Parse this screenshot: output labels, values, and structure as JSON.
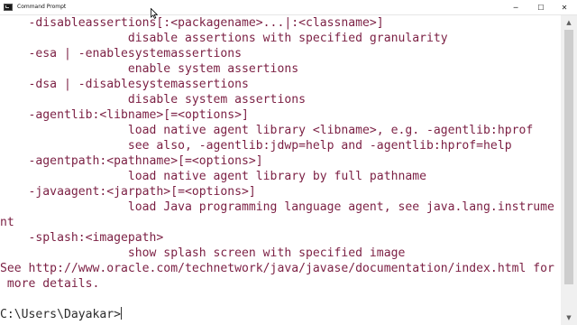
{
  "window": {
    "title": "Command Prompt",
    "min_glyph": "─",
    "max_glyph": "☐",
    "close_glyph": "✕"
  },
  "console": {
    "lines": [
      "    -disableassertions[:<packagename>...|:<classname>]",
      "                  disable assertions with specified granularity",
      "    -esa | -enablesystemassertions",
      "                  enable system assertions",
      "    -dsa | -disablesystemassertions",
      "                  disable system assertions",
      "    -agentlib:<libname>[=<options>]",
      "                  load native agent library <libname>, e.g. -agentlib:hprof",
      "                  see also, -agentlib:jdwp=help and -agentlib:hprof=help",
      "    -agentpath:<pathname>[=<options>]",
      "                  load native agent library by full pathname",
      "    -javaagent:<jarpath>[=<options>]",
      "                  load Java programming language agent, see java.lang.instrume",
      "nt",
      "    -splash:<imagepath>",
      "                  show splash screen with specified image",
      "See http://www.oracle.com/technetwork/java/javase/documentation/index.html for",
      " more details.",
      ""
    ],
    "prompt": "C:\\Users\\Dayakar>"
  },
  "scrollbar": {
    "up_glyph": "▲",
    "down_glyph": "▼"
  },
  "colors": {
    "output_text": "#7b1f43",
    "prompt_text": "#2b2b2b",
    "background": "#ffffff"
  }
}
